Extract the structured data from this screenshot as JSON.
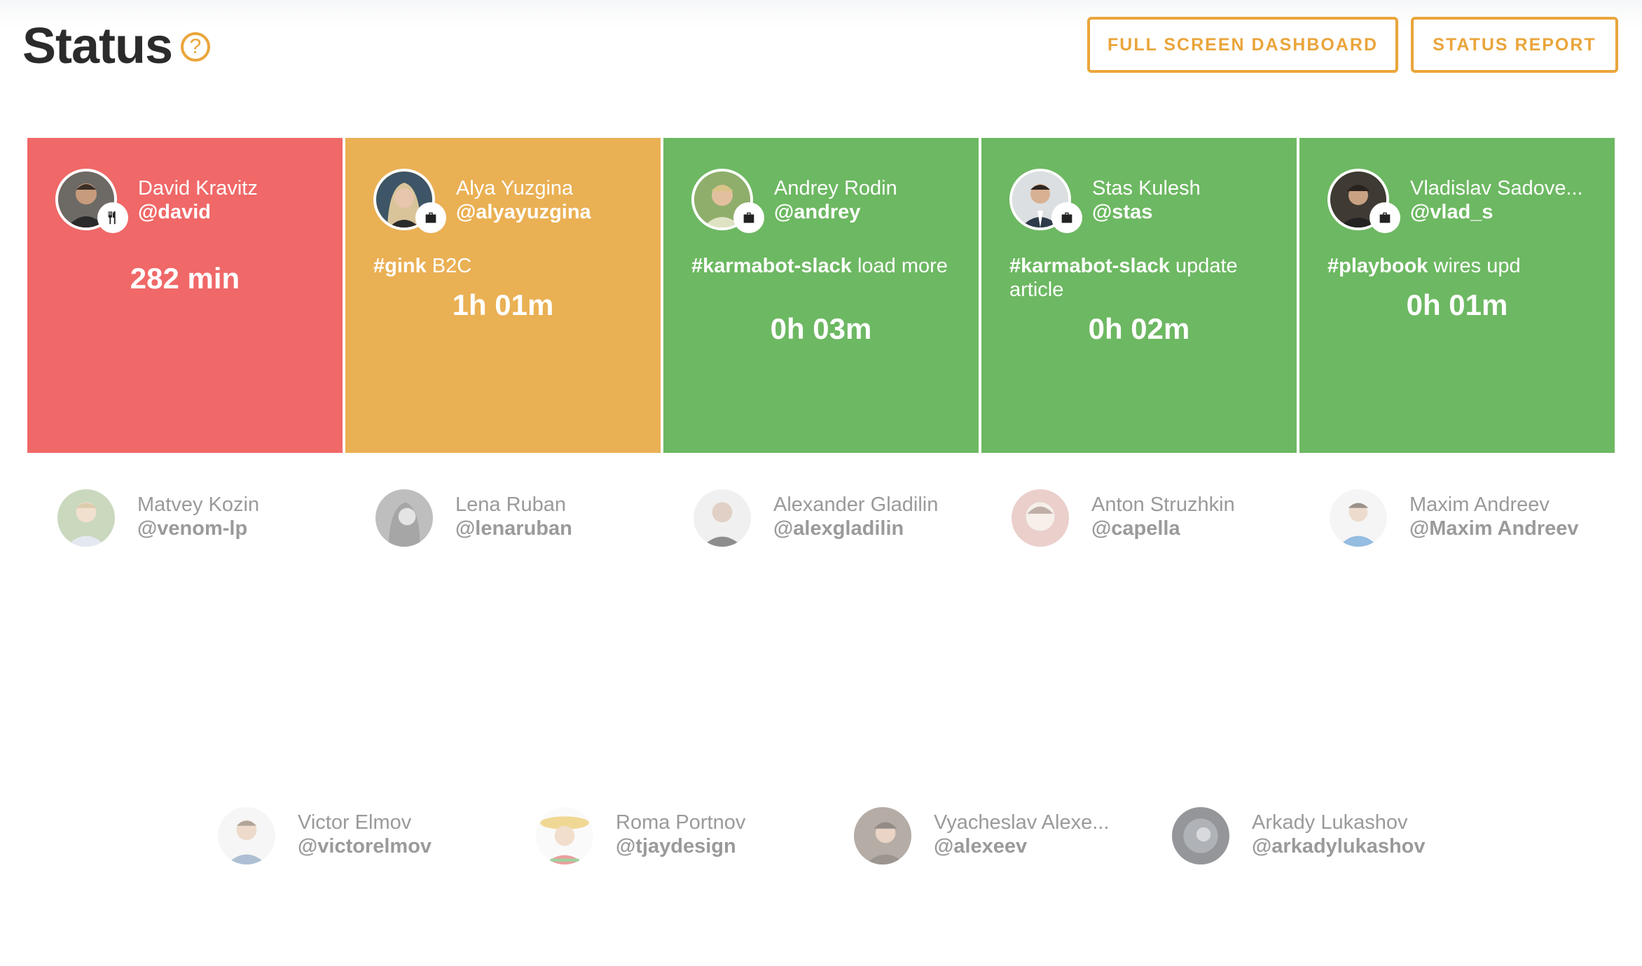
{
  "page": {
    "title": "Status",
    "help_glyph": "?"
  },
  "toolbar": {
    "full_screen_label": "FULL SCREEN DASHBOARD",
    "status_report_label": "STATUS REPORT"
  },
  "colors": {
    "accent": "#eaa53b",
    "red": "#f06868",
    "orange": "#eab054",
    "green": "#6db862",
    "muted_text": "#9a9a9a"
  },
  "active_cards": [
    {
      "name": "David Kravitz",
      "handle": "@david",
      "color": "#f06868",
      "badge_icon": "fork-knife-icon",
      "task_tag": "",
      "task_text": "",
      "duration": "282 min"
    },
    {
      "name": "Alya Yuzgina",
      "handle": "@alyayuzgina",
      "color": "#eab054",
      "badge_icon": "briefcase-icon",
      "task_tag": "#gink",
      "task_text": " B2C",
      "duration": "1h 01m"
    },
    {
      "name": "Andrey Rodin",
      "handle": "@andrey",
      "color": "#6db862",
      "badge_icon": "briefcase-icon",
      "task_tag": "#karmabot-slack",
      "task_text": " load more",
      "duration": "0h 03m"
    },
    {
      "name": "Stas Kulesh",
      "handle": "@stas",
      "color": "#6db862",
      "badge_icon": "briefcase-icon",
      "task_tag": "#karmabot-slack",
      "task_text": " update article",
      "duration": "0h 02m"
    },
    {
      "name": "Vladislav Sadove...",
      "handle": "@vlad_s",
      "color": "#6db862",
      "badge_icon": "briefcase-icon",
      "task_tag": "#playbook",
      "task_text": " wires upd",
      "duration": "0h 01m"
    }
  ],
  "inactive_row1": [
    {
      "name": "Matvey Kozin",
      "handle": "@venom-lp"
    },
    {
      "name": "Lena Ruban",
      "handle": "@lenaruban"
    },
    {
      "name": "Alexander Gladilin",
      "handle": "@alexgladilin"
    },
    {
      "name": "Anton Struzhkin",
      "handle": "@capella"
    },
    {
      "name": "Maxim Andreev",
      "handle": "@Maxim Andreev"
    }
  ],
  "inactive_row2": [
    {
      "name": "Victor Elmov",
      "handle": "@victorelmov"
    },
    {
      "name": "Roma Portnov",
      "handle": "@tjaydesign"
    },
    {
      "name": "Vyacheslav Alexe...",
      "handle": "@alexeev"
    },
    {
      "name": "Arkady Lukashov",
      "handle": "@arkadylukashov"
    }
  ]
}
